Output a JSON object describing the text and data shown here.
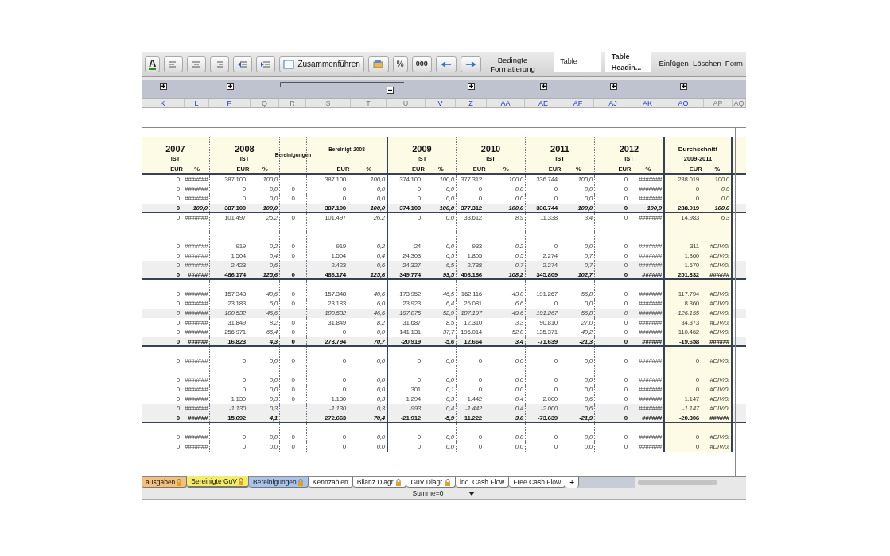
{
  "toolbar": {
    "font_color": "A",
    "merge_button": "Zusammenführen",
    "percent": "%",
    "thousands": "000",
    "conditional": "Bedingte Formatierung",
    "styles": [
      "Table",
      "Table Headin..."
    ],
    "actions": [
      "Einfügen",
      "Löschen",
      "Form"
    ]
  },
  "columns": [
    {
      "letter": "K",
      "marked": true
    },
    {
      "letter": "L",
      "marked": true
    },
    {
      "letter": "P",
      "marked": true
    },
    {
      "letter": "Q",
      "marked": false
    },
    {
      "letter": "R",
      "marked": false
    },
    {
      "letter": "S",
      "marked": false
    },
    {
      "letter": "T",
      "marked": false
    },
    {
      "letter": "U",
      "marked": false
    },
    {
      "letter": "V",
      "marked": true
    },
    {
      "letter": "Z",
      "marked": true
    },
    {
      "letter": "AA",
      "marked": true
    },
    {
      "letter": "AE",
      "marked": true
    },
    {
      "letter": "AF",
      "marked": true
    },
    {
      "letter": "AJ",
      "marked": true
    },
    {
      "letter": "AK",
      "marked": true
    },
    {
      "letter": "AO",
      "marked": true
    },
    {
      "letter": "AP",
      "marked": false
    },
    {
      "letter": "AQ",
      "marked": false
    }
  ],
  "header": [
    {
      "kind": "year",
      "year": "2007",
      "sub": "IST",
      "eur": "EUR",
      "pct": "%"
    },
    {
      "kind": "year",
      "year": "2008",
      "sub": "IST",
      "eur": "EUR",
      "pct": "%"
    },
    {
      "kind": "single",
      "label": "Bereinigungen"
    },
    {
      "kind": "adjusted",
      "label": "Bereinigt",
      "year": "2008",
      "eur": "EUR",
      "pct": "%"
    },
    {
      "kind": "year",
      "year": "2009",
      "sub": "IST",
      "eur": "EUR",
      "pct": "%"
    },
    {
      "kind": "year",
      "year": "2010",
      "sub": "IST",
      "eur": "EUR",
      "pct": "%"
    },
    {
      "kind": "year",
      "year": "2011",
      "sub": "IST",
      "eur": "EUR",
      "pct": "%"
    },
    {
      "kind": "year",
      "year": "2012",
      "sub": "IST",
      "eur": "EUR",
      "pct": "%"
    },
    {
      "kind": "year",
      "year": "Durchschnitt",
      "sub": "2009-2011",
      "eur": "EUR",
      "pct": "%"
    }
  ],
  "rows": [
    {
      "kind": "item",
      "groups": [
        [
          "0",
          "#######"
        ],
        [
          "387.100",
          "100,0"
        ],
        [
          "387.100",
          "100,0"
        ],
        [
          "374.100",
          "100,0"
        ],
        [
          "377.312",
          "100,0"
        ],
        [
          "336.744",
          "100,0"
        ],
        [
          "0",
          "#######"
        ],
        [
          "238.019",
          "100,0"
        ]
      ]
    },
    {
      "kind": "item",
      "adjustment": "0",
      "groups": [
        [
          "0",
          "#######"
        ],
        [
          "0",
          "0,0"
        ],
        [
          "0",
          "0,0"
        ],
        [
          "0",
          "0,0"
        ],
        [
          "0",
          "0,0"
        ],
        [
          "0",
          "0,0"
        ],
        [
          "0",
          "#######"
        ],
        [
          "0",
          "0,0"
        ]
      ]
    },
    {
      "kind": "item",
      "adjustment": "0",
      "groups": [
        [
          "0",
          "#######"
        ],
        [
          "0",
          "0,0"
        ],
        [
          "0",
          "0,0"
        ],
        [
          "0",
          "0,0"
        ],
        [
          "0",
          "0,0"
        ],
        [
          "0",
          "0,0"
        ],
        [
          "0",
          "#######"
        ],
        [
          "0",
          "0,0"
        ]
      ]
    },
    {
      "kind": "total",
      "groups": [
        [
          "0",
          "100,0"
        ],
        [
          "387.100",
          "100,0"
        ],
        [
          "387.100",
          "100,0"
        ],
        [
          "374.100",
          "100,0"
        ],
        [
          "377.312",
          "100,0"
        ],
        [
          "336.744",
          "100,0"
        ],
        [
          "0",
          "100,0"
        ],
        [
          "238.019",
          "100,0"
        ]
      ]
    },
    {
      "kind": "item",
      "adjustment": "0",
      "groups": [
        [
          "0",
          "#######"
        ],
        [
          "101.497",
          "26,2"
        ],
        [
          "101.497",
          "26,2"
        ],
        [
          "0",
          "0,0"
        ],
        [
          "33.612",
          "8,9"
        ],
        [
          "11.338",
          "3,4"
        ],
        [
          "0",
          "#######"
        ],
        [
          "14.983",
          "6,3"
        ]
      ]
    },
    {
      "kind": "blank"
    },
    {
      "kind": "blank"
    },
    {
      "kind": "item",
      "adjustment": "0",
      "groups": [
        [
          "0",
          "#######"
        ],
        [
          "919",
          "0,2"
        ],
        [
          "919",
          "0,2"
        ],
        [
          "24",
          "0,0"
        ],
        [
          "933",
          "0,2"
        ],
        [
          "0",
          "0,0"
        ],
        [
          "0",
          "#######"
        ],
        [
          "311",
          "#DIV/0!"
        ]
      ]
    },
    {
      "kind": "item",
      "adjustment": "0",
      "groups": [
        [
          "0",
          "#######"
        ],
        [
          "1.504",
          "0,4"
        ],
        [
          "1.504",
          "0,4"
        ],
        [
          "24.303",
          "6,5"
        ],
        [
          "1.805",
          "0,5"
        ],
        [
          "2.274",
          "0,7"
        ],
        [
          "0",
          "#######"
        ],
        [
          "1.360",
          "#DIV/0!"
        ]
      ]
    },
    {
      "kind": "shaded",
      "groups": [
        [
          "0",
          "#######"
        ],
        [
          "2.423",
          "0,6"
        ],
        [
          "2.423",
          "0,6"
        ],
        [
          "24.327",
          "6,5"
        ],
        [
          "2.738",
          "0,7"
        ],
        [
          "2.274",
          "0,7"
        ],
        [
          "0",
          "#######"
        ],
        [
          "1.670",
          "#DIV/0!"
        ]
      ]
    },
    {
      "kind": "total",
      "adjustment": "0",
      "groups": [
        [
          "0",
          "######"
        ],
        [
          "486.174",
          "125,6"
        ],
        [
          "486.174",
          "125,6"
        ],
        [
          "349.774",
          "93,5"
        ],
        [
          "408.186",
          "108,2"
        ],
        [
          "345.809",
          "102,7"
        ],
        [
          "0",
          "######"
        ],
        [
          "251.332",
          "######"
        ]
      ]
    },
    {
      "kind": "blank"
    },
    {
      "kind": "item",
      "adjustment": "0",
      "groups": [
        [
          "0",
          "#######"
        ],
        [
          "157.348",
          "40,6"
        ],
        [
          "157.348",
          "40,6"
        ],
        [
          "173.952",
          "46,5"
        ],
        [
          "162.116",
          "43,0"
        ],
        [
          "191.267",
          "56,8"
        ],
        [
          "0",
          "#######"
        ],
        [
          "117.794",
          "#DIV/0!"
        ]
      ]
    },
    {
      "kind": "item",
      "adjustment": "0",
      "groups": [
        [
          "0",
          "#######"
        ],
        [
          "23.183",
          "6,0"
        ],
        [
          "23.183",
          "6,0"
        ],
        [
          "23.923",
          "6,4"
        ],
        [
          "25.081",
          "6,6"
        ],
        [
          "0",
          "0,0"
        ],
        [
          "0",
          "#######"
        ],
        [
          "8.360",
          "#DIV/0!"
        ]
      ]
    },
    {
      "kind": "subtotal",
      "groups": [
        [
          "0",
          "#######"
        ],
        [
          "180.532",
          "46,6"
        ],
        [
          "180.532",
          "46,6"
        ],
        [
          "197.875",
          "52,9"
        ],
        [
          "187.197",
          "49,6"
        ],
        [
          "191.267",
          "56,8"
        ],
        [
          "0",
          "#######"
        ],
        [
          "126.155",
          "#DIV/0!"
        ]
      ]
    },
    {
      "kind": "item",
      "adjustment": "0",
      "groups": [
        [
          "0",
          "#######"
        ],
        [
          "31.849",
          "8,2"
        ],
        [
          "31.849",
          "8,2"
        ],
        [
          "31.687",
          "8,5"
        ],
        [
          "12.310",
          "3,3"
        ],
        [
          "90.810",
          "27,0"
        ],
        [
          "0",
          "#######"
        ],
        [
          "34.373",
          "#DIV/0!"
        ]
      ]
    },
    {
      "kind": "item",
      "adjustment": "0",
      "groups": [
        [
          "0",
          "#######"
        ],
        [
          "256.971",
          "66,4"
        ],
        [
          "0",
          "0,0"
        ],
        [
          "141.131",
          "37,7"
        ],
        [
          "196.014",
          "52,0"
        ],
        [
          "135.371",
          "40,2"
        ],
        [
          "0",
          "#######"
        ],
        [
          "110.462",
          "#DIV/0!"
        ]
      ]
    },
    {
      "kind": "total",
      "adjustment": "0",
      "groups": [
        [
          "0",
          "######"
        ],
        [
          "16.823",
          "4,3"
        ],
        [
          "273.794",
          "70,7"
        ],
        [
          "-20.919",
          "-5,6"
        ],
        [
          "12.664",
          "3,4"
        ],
        [
          "-71.639",
          "-21,3"
        ],
        [
          "0",
          "######"
        ],
        [
          "-19.658",
          "######"
        ]
      ]
    },
    {
      "kind": "blank"
    },
    {
      "kind": "item",
      "adjustment": "0",
      "groups": [
        [
          "0",
          "#######"
        ],
        [
          "0",
          "0,0"
        ],
        [
          "0",
          "0,0"
        ],
        [
          "0",
          "0,0"
        ],
        [
          "0",
          "0,0"
        ],
        [
          "0",
          "0,0"
        ],
        [
          "0",
          "#######"
        ],
        [
          "0",
          "#DIV/0!"
        ]
      ]
    },
    {
      "kind": "blank"
    },
    {
      "kind": "item",
      "adjustment": "0",
      "groups": [
        [
          "0",
          "#######"
        ],
        [
          "0",
          "0,0"
        ],
        [
          "0",
          "0,0"
        ],
        [
          "0",
          "0,0"
        ],
        [
          "0",
          "0,0"
        ],
        [
          "0",
          "0,0"
        ],
        [
          "0",
          "#######"
        ],
        [
          "0",
          "#DIV/0!"
        ]
      ]
    },
    {
      "kind": "item",
      "adjustment": "0",
      "groups": [
        [
          "0",
          "#######"
        ],
        [
          "0",
          "0,0"
        ],
        [
          "0",
          "0,0"
        ],
        [
          "301",
          "0,1"
        ],
        [
          "0",
          "0,0"
        ],
        [
          "0",
          "0,0"
        ],
        [
          "0",
          "#######"
        ],
        [
          "0",
          "#DIV/0!"
        ]
      ]
    },
    {
      "kind": "item",
      "adjustment": "0",
      "groups": [
        [
          "0",
          "#######"
        ],
        [
          "1.130",
          "0,3"
        ],
        [
          "1.130",
          "0,3"
        ],
        [
          "1.294",
          "0,3"
        ],
        [
          "1.442",
          "0,4"
        ],
        [
          "2.000",
          "0,6"
        ],
        [
          "0",
          "#######"
        ],
        [
          "1.147",
          "#DIV/0!"
        ]
      ]
    },
    {
      "kind": "subtotal",
      "groups": [
        [
          "0",
          "#######"
        ],
        [
          "-1.130",
          "0,3"
        ],
        [
          "-1.130",
          "0,3"
        ],
        [
          "-993",
          "0,4"
        ],
        [
          "-1.442",
          "0,4"
        ],
        [
          "-2.000",
          "0,6"
        ],
        [
          "0",
          "#######"
        ],
        [
          "-1.147",
          "#DIV/0!"
        ]
      ]
    },
    {
      "kind": "total",
      "groups": [
        [
          "0",
          "######"
        ],
        [
          "15.692",
          "4,1"
        ],
        [
          "272.663",
          "70,4"
        ],
        [
          "-21.912",
          "-5,9"
        ],
        [
          "11.222",
          "3,0"
        ],
        [
          "-73.639",
          "-21,9"
        ],
        [
          "0",
          "######"
        ],
        [
          "-20.806",
          "######"
        ]
      ]
    },
    {
      "kind": "blank"
    },
    {
      "kind": "item",
      "adjustment": "0",
      "groups": [
        [
          "0",
          "#######"
        ],
        [
          "0",
          "0,0"
        ],
        [
          "0",
          "0,0"
        ],
        [
          "0",
          "0,0"
        ],
        [
          "0",
          "0,0"
        ],
        [
          "0",
          "0,0"
        ],
        [
          "0",
          "#######"
        ],
        [
          "0",
          "#DIV/0!"
        ]
      ]
    },
    {
      "kind": "item",
      "adjustment": "0",
      "groups": [
        [
          "0",
          "#######"
        ],
        [
          "0",
          "0,0"
        ],
        [
          "0",
          "0,0"
        ],
        [
          "0",
          "0,0"
        ],
        [
          "0",
          "0,0"
        ],
        [
          "0",
          "0,0"
        ],
        [
          "0",
          "#######"
        ],
        [
          "0",
          "#DIV/0!"
        ]
      ]
    }
  ],
  "sheet_tabs": [
    {
      "label": "ausgaben",
      "color": "#f3c07e",
      "locked": true,
      "selected": false
    },
    {
      "label": "Bereinigte GuV",
      "color": "#f4ec6c",
      "locked": true,
      "selected": true
    },
    {
      "label": "Bereinigungen",
      "color": "#a9c4ec",
      "locked": true,
      "selected": false
    },
    {
      "label": "Kennzahlen",
      "color": "#ffffff",
      "locked": false,
      "selected": false
    },
    {
      "label": "Bilanz Diagr.",
      "color": "#ffffff",
      "locked": true,
      "selected": false
    },
    {
      "label": "GuV Diagr.",
      "color": "#ffffff",
      "locked": true,
      "selected": false
    },
    {
      "label": "ind. Cash Flow",
      "color": "#ffffff",
      "locked": false,
      "selected": false
    },
    {
      "label": "Free Cash Flow",
      "color": "#ffffff",
      "locked": false,
      "selected": false
    }
  ],
  "add_tab": "+",
  "status_bar": {
    "sum": "Summe=0"
  }
}
